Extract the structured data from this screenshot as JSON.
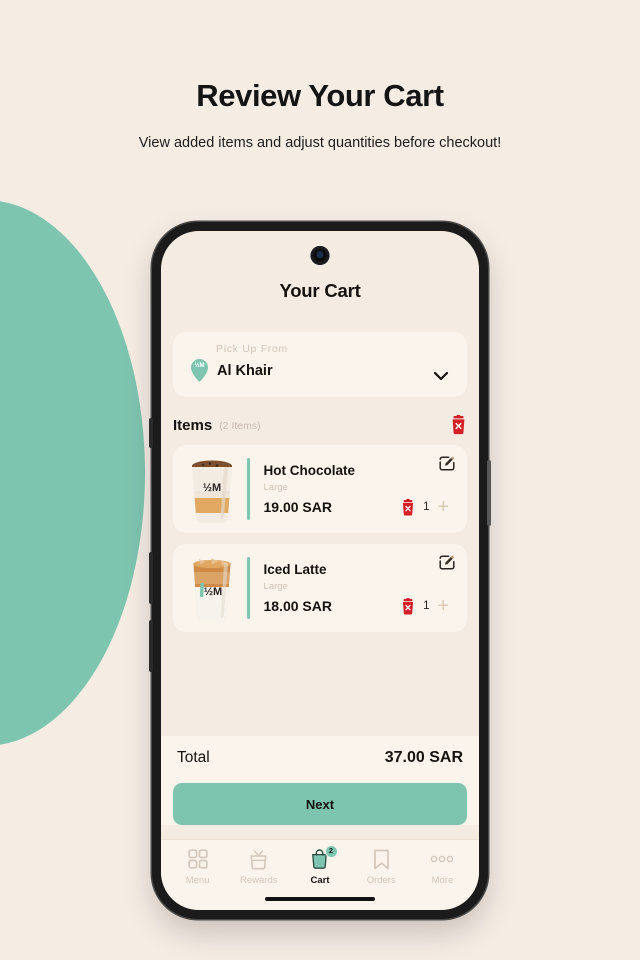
{
  "promo": {
    "title": "Review Your Cart",
    "subtitle": "View added items and adjust quantities before checkout!"
  },
  "theme": {
    "page_bg": "#f5ece4",
    "accent_teal": "#7ec5b0",
    "card_bg": "#fbf4ec",
    "screen_bg": "#f4ebe2",
    "danger_red": "#d31f26",
    "muted_text": "#cfc3b6"
  },
  "app": {
    "title": "Your Cart",
    "pickup": {
      "label": "Pick Up From",
      "branch": "Al Khair",
      "pin_icon": "map-pin-icon",
      "pin_text": "½M",
      "chevron_icon": "chevron-down-icon"
    },
    "items_header": {
      "title": "Items",
      "count": "(2 Items)",
      "delete_all_icon": "trash-icon"
    },
    "items": [
      {
        "name": "Hot Chocolate",
        "size": "Large",
        "price": "19.00 SAR",
        "quantity": "1",
        "image_name": "hot-chocolate-cup-image",
        "logo_text": "½M",
        "edit_icon": "edit-pencil-icon",
        "delete_icon": "trash-icon",
        "plus_icon": "plus-icon"
      },
      {
        "name": "Iced Latte",
        "size": "Large",
        "price": "18.00 SAR",
        "quantity": "1",
        "image_name": "iced-latte-cup-image",
        "logo_text": "½M",
        "edit_icon": "edit-pencil-icon",
        "delete_icon": "trash-icon",
        "plus_icon": "plus-icon"
      }
    ],
    "totals": {
      "label": "Total",
      "value": "37.00 SAR"
    },
    "primary_action": "Next",
    "tabbar": [
      {
        "label": "Menu",
        "icon": "grid-icon",
        "active": false,
        "badge": ""
      },
      {
        "label": "Rewards",
        "icon": "gift-bag-icon",
        "active": false,
        "badge": ""
      },
      {
        "label": "Cart",
        "icon": "cart-bag-icon",
        "active": true,
        "badge": "2"
      },
      {
        "label": "Orders",
        "icon": "bookmark-icon",
        "active": false,
        "badge": ""
      },
      {
        "label": "More",
        "icon": "ellipsis-icon",
        "active": false,
        "badge": ""
      }
    ]
  }
}
